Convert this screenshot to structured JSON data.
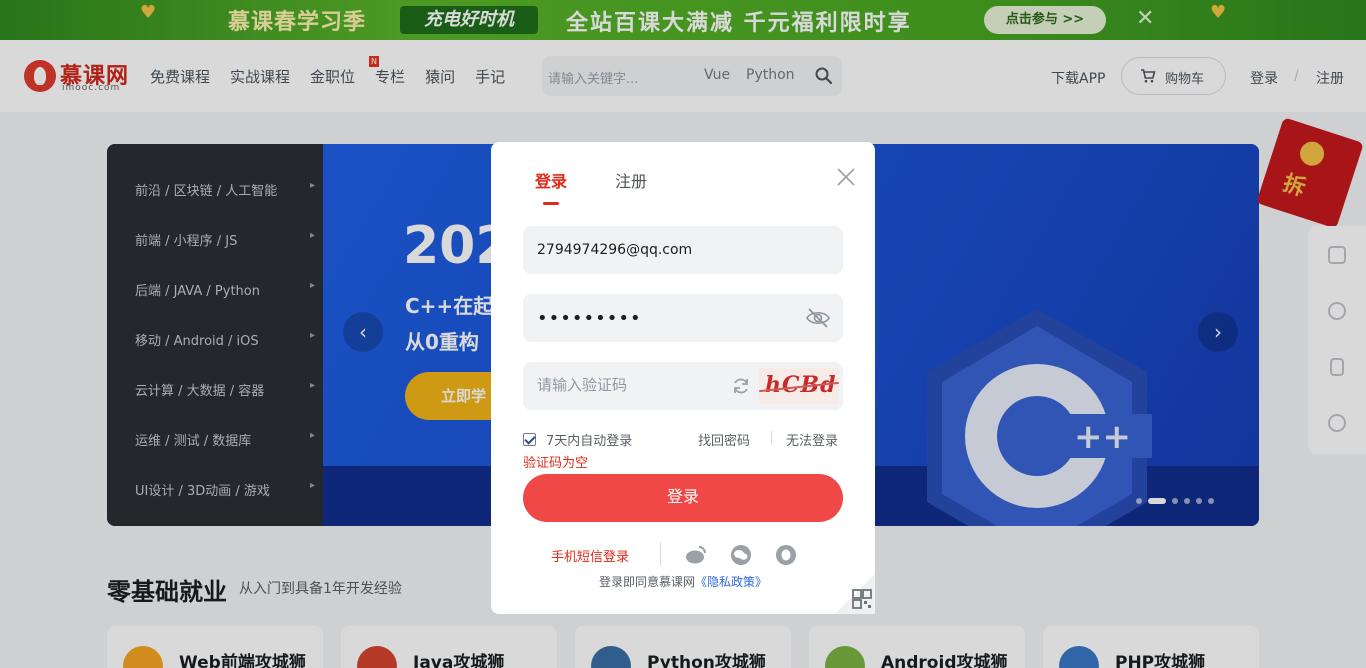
{
  "promo": {
    "title": "慕课春学习季",
    "tag": "充电好时机",
    "headline": "全站百课大满减 千元福利限时享",
    "join_button": "点击参与 >>",
    "close": "✕"
  },
  "nav": {
    "logo_cn": "慕课网",
    "logo_en": "imooc.com",
    "links": [
      "免费课程",
      "实战课程",
      "金职位",
      "专栏",
      "猿问",
      "手记"
    ],
    "badge": "N",
    "search": {
      "placeholder": "请输入关键字...",
      "hot_words": [
        "Vue",
        "Python"
      ]
    },
    "download_app": "下载APP",
    "cart": "购物车",
    "login": "登录",
    "separator": "/",
    "register": "注册"
  },
  "categories": [
    "前沿 / 区块链 / 人工智能",
    "前端 / 小程序 / JS",
    "后端 / JAVA / Python",
    "移动 / Android / iOS",
    "云计算 / 大数据 / 容器",
    "运维 / 测试 / 数据库",
    "UI设计 / 3D动画 / 游戏"
  ],
  "banner": {
    "year": "202",
    "line1": "C++在起",
    "line2": "从0重构",
    "cta": "立即学"
  },
  "red_envelope": "拆",
  "section": {
    "title": "零基础就业",
    "subtitle": "从入门到具备1年开发经验",
    "cards": [
      "Web前端攻城狮",
      "Java攻城狮",
      "Python攻城狮",
      "Android攻城狮",
      "PHP攻城狮"
    ]
  },
  "modal": {
    "tab_login": "登录",
    "tab_register": "注册",
    "email_value": "2794974296@qq.com",
    "password_value": "passwordx",
    "captcha_placeholder": "请输入验证码",
    "captcha_text": "hCBd",
    "remember_label": "7天内自动登录",
    "remember_checked": true,
    "forgot_password": "找回密码",
    "cannot_login": "无法登录",
    "error_message": "验证码为空",
    "login_button": "登录",
    "sms_login": "手机短信登录",
    "agreement_prefix": "登录即同意慕课网",
    "agreement_link": "《隐私政策》"
  },
  "colors": {
    "brand_red": "#e12a18",
    "login_button": "#f04846",
    "promo_green": "#4aa823",
    "hero_blue": "#1a5de0"
  },
  "icons": {
    "search": "search-icon",
    "cart": "cart-icon",
    "close": "close-icon",
    "eye_off": "eye-off-icon",
    "refresh": "refresh-icon",
    "weibo": "weibo-icon",
    "wechat": "wechat-icon",
    "qq": "qq-icon",
    "qr_code": "qr-code-icon"
  }
}
